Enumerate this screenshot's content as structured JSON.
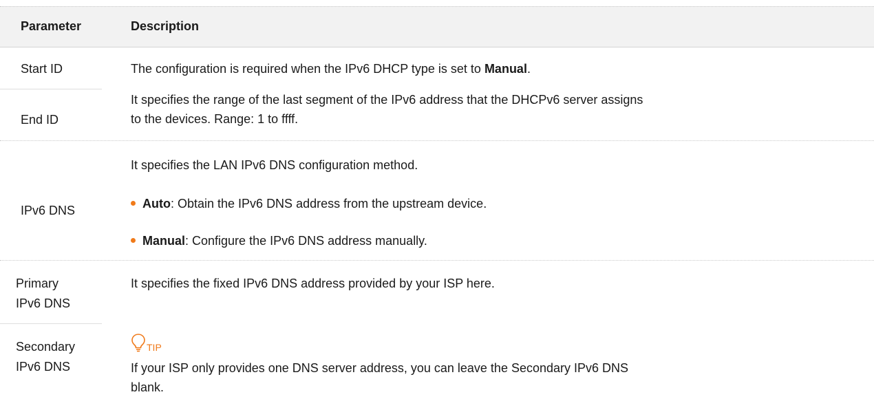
{
  "table": {
    "headers": {
      "parameter": "Parameter",
      "description": "Description"
    },
    "rows": {
      "start_id": {
        "param": "Start ID",
        "desc_prefix": "The configuration is required when the IPv6 DHCP type is set to ",
        "desc_bold": "Manual",
        "desc_suffix": "."
      },
      "end_id": {
        "param": "End ID",
        "desc_line1": "It specifies the range of the last segment of the IPv6 address that the DHCPv6 server assigns",
        "desc_line2": "to the devices. Range: 1 to ffff."
      },
      "ipv6_dns": {
        "param": "IPv6 DNS",
        "desc_intro": "It specifies the LAN IPv6 DNS configuration method.",
        "bullets": [
          {
            "term": "Auto",
            "text": ": Obtain the IPv6 DNS address from the upstream device."
          },
          {
            "term": "Manual",
            "text": ": Configure the IPv6 DNS address manually."
          }
        ]
      },
      "primary_dns": {
        "param_line1": "Primary",
        "param_line2": "IPv6 DNS",
        "desc": "It specifies the fixed IPv6 DNS address provided by your ISP here."
      },
      "tip": {
        "label": "TIP",
        "icon": "lightbulb-icon"
      },
      "secondary_dns": {
        "param_line1": "Secondary",
        "param_line2": "IPv6 DNS",
        "desc_line1": "If your ISP only provides one DNS server address, you can leave the Secondary IPv6 DNS",
        "desc_line2": "blank."
      }
    }
  },
  "colors": {
    "accent": "#f07a1a",
    "header_bg": "#f2f2f2",
    "rule": "#d4d4d4"
  }
}
